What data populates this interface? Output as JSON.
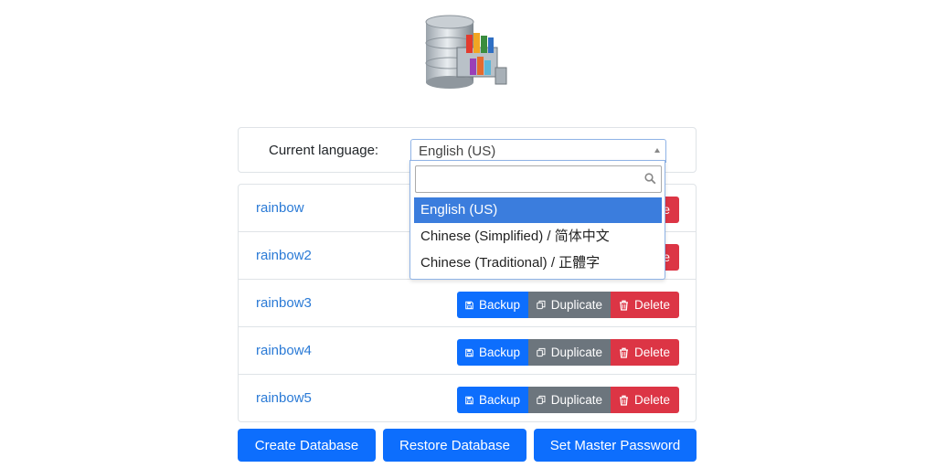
{
  "language": {
    "label": "Current language:",
    "selected": "English (US)",
    "search_value": "",
    "options": [
      "English (US)",
      "Chinese (Simplified) / 简体中文",
      "Chinese (Traditional) / 正體字"
    ]
  },
  "databases": [
    {
      "name": "rainbow"
    },
    {
      "name": "rainbow2"
    },
    {
      "name": "rainbow3"
    },
    {
      "name": "rainbow4"
    },
    {
      "name": "rainbow5"
    }
  ],
  "row_actions": {
    "backup": "Backup",
    "duplicate": "Duplicate",
    "delete": "Delete"
  },
  "actions": {
    "create": "Create Database",
    "restore": "Restore Database",
    "master_password": "Set Master Password"
  },
  "icons": {
    "logo": "database-cabinet-icon",
    "backup": "floppy-disk-icon",
    "duplicate": "copy-icon",
    "delete": "trash-icon",
    "search": "magnifier-icon"
  },
  "colors": {
    "primary": "#0d6efd",
    "secondary": "#6c757d",
    "danger": "#dc3545",
    "link": "#2a7ad6",
    "selected_option": "#3b7ddd"
  }
}
